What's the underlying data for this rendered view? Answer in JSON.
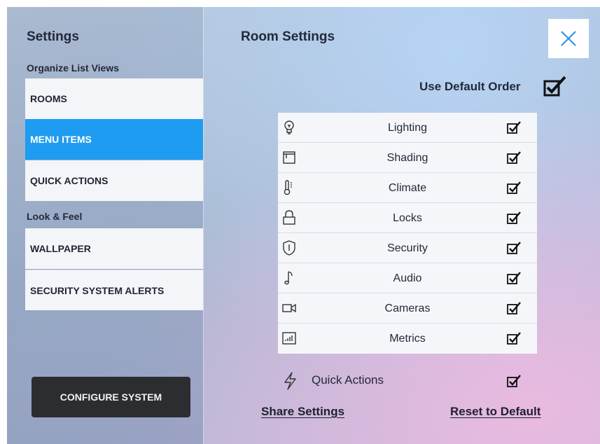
{
  "sidebar": {
    "title": "Settings",
    "section_organize": "Organize List Views",
    "organize_items": [
      {
        "label": "ROOMS",
        "active": false
      },
      {
        "label": "MENU ITEMS",
        "active": true
      },
      {
        "label": "QUICK ACTIONS",
        "active": false
      }
    ],
    "section_look": "Look & Feel",
    "look_items": [
      {
        "label": "WALLPAPER"
      },
      {
        "label": "SECURITY SYSTEM ALERTS"
      }
    ],
    "configure_button": "CONFIGURE SYSTEM"
  },
  "main": {
    "title": "Room Settings",
    "close_icon": "close-icon",
    "use_default_order": {
      "label": "Use Default Order",
      "checked": true
    },
    "menu_items": [
      {
        "label": "Lighting",
        "icon": "lightbulb-icon",
        "checked": true
      },
      {
        "label": "Shading",
        "icon": "shade-icon",
        "checked": true
      },
      {
        "label": "Climate",
        "icon": "thermometer-icon",
        "checked": true
      },
      {
        "label": "Locks",
        "icon": "lock-icon",
        "checked": true
      },
      {
        "label": "Security",
        "icon": "shield-icon",
        "checked": true
      },
      {
        "label": "Audio",
        "icon": "music-note-icon",
        "checked": true
      },
      {
        "label": "Cameras",
        "icon": "camera-icon",
        "checked": true
      },
      {
        "label": "Metrics",
        "icon": "metrics-chart-icon",
        "checked": true
      }
    ],
    "quick_actions": {
      "label": "Quick Actions",
      "icon": "lightning-bolt-icon",
      "checked": true
    },
    "share_settings": "Share Settings",
    "reset_default": "Reset to Default"
  },
  "colors": {
    "accent": "#1e9cf1",
    "item_bg": "#f4f5f8",
    "button_dark": "#2c2d31",
    "text_dark": "#23293a"
  }
}
